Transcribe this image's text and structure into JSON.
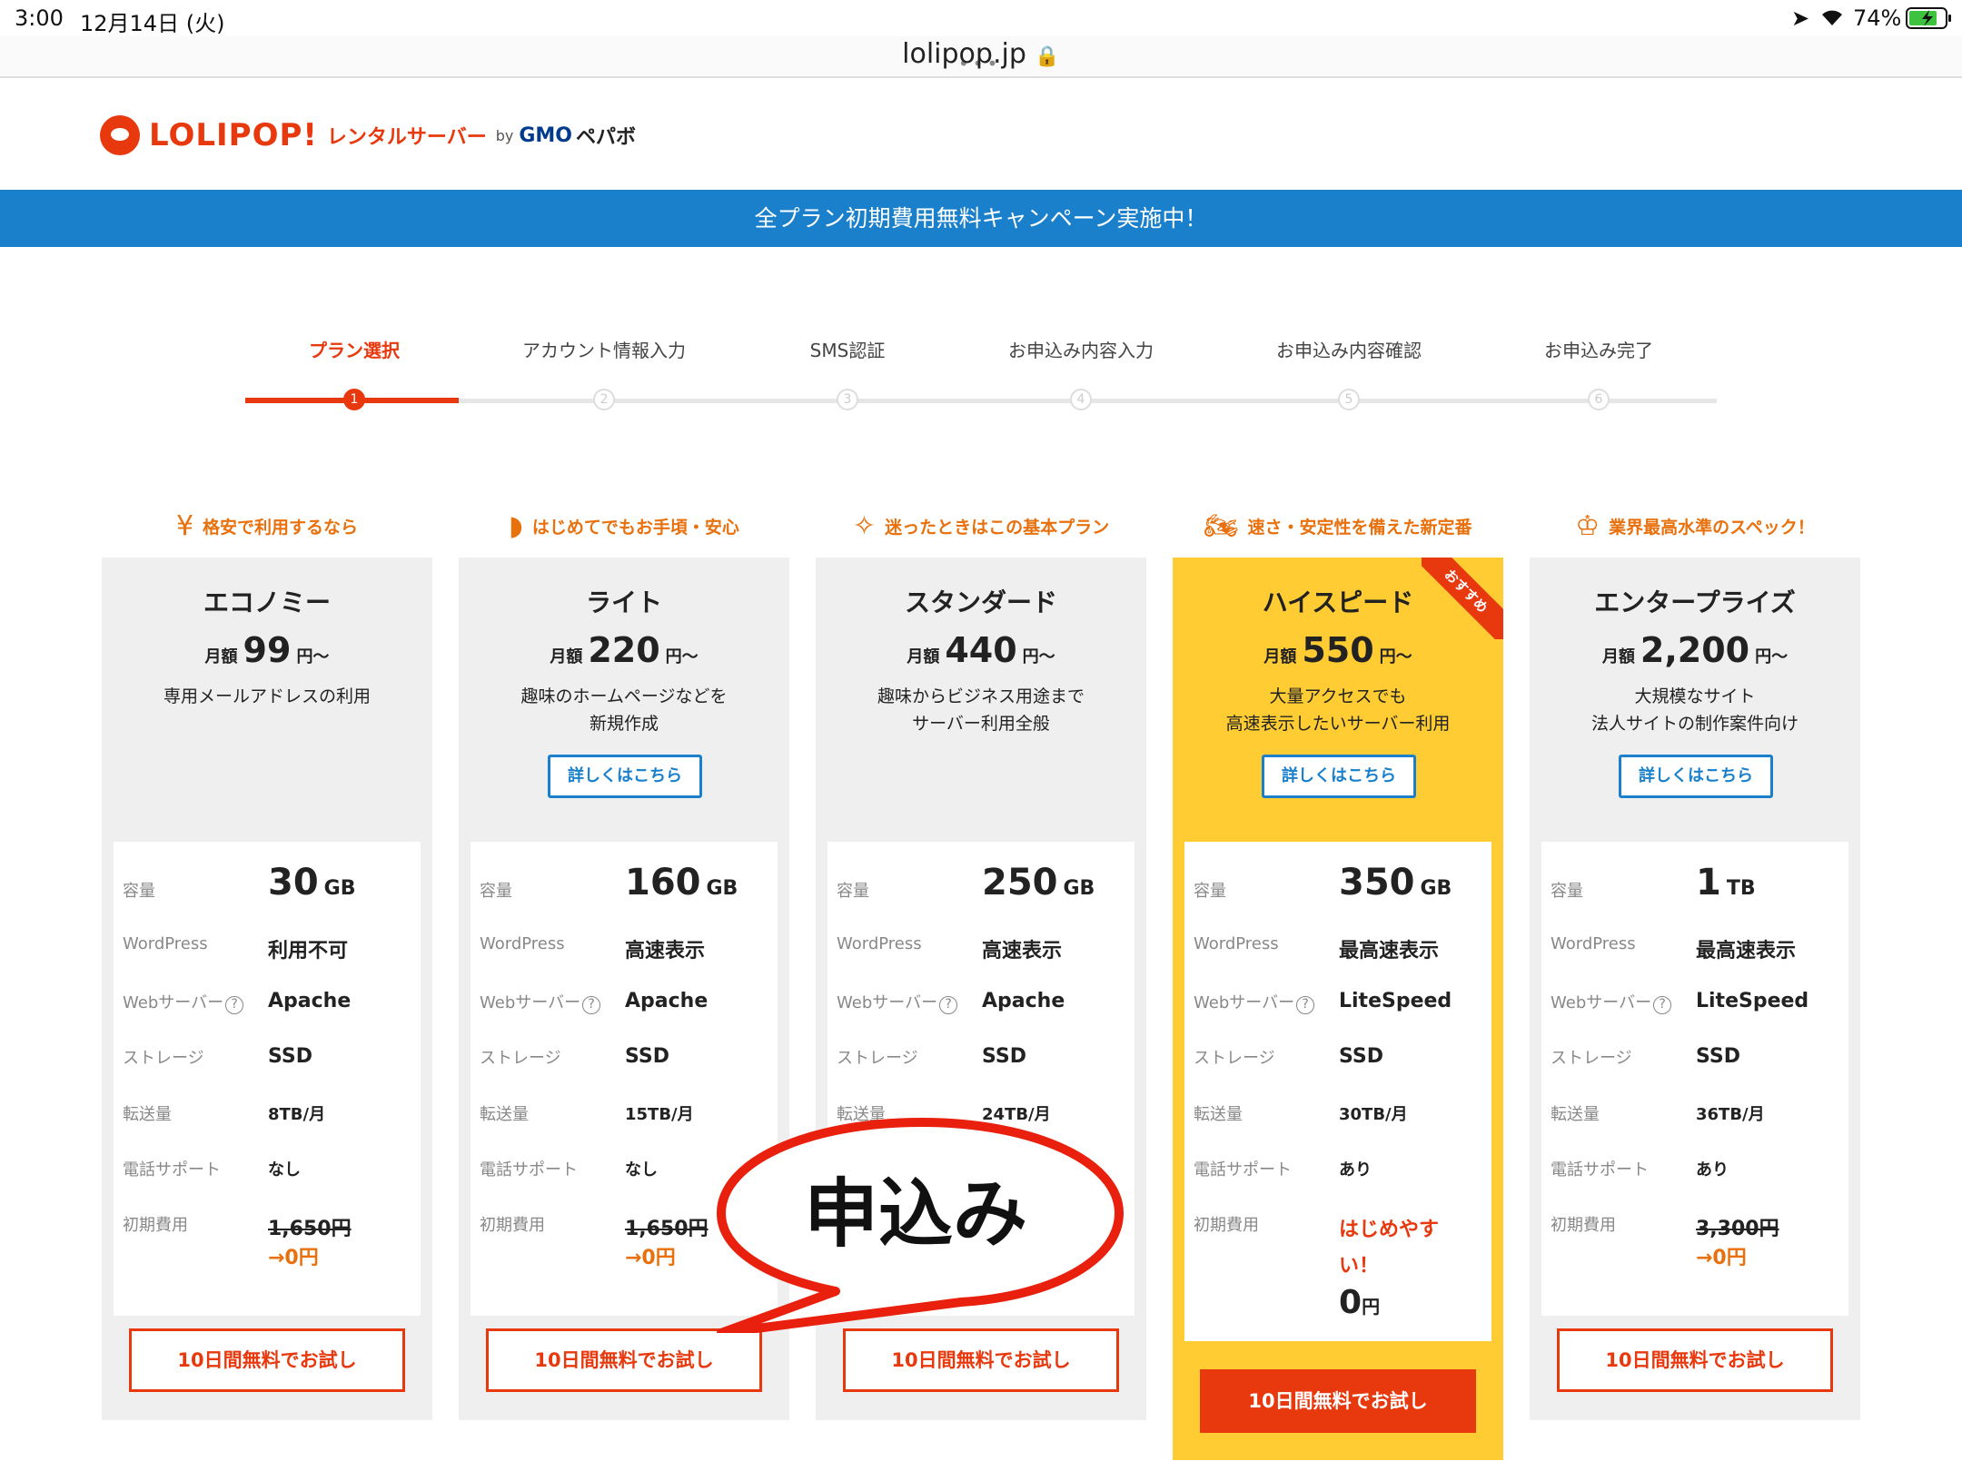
{
  "status": {
    "time": "3:00",
    "date": "12月14日 (火)",
    "battery": "74%"
  },
  "browser": {
    "url": "lolipop.jp"
  },
  "header": {
    "brand": "LOLIPOP!",
    "sub": "レンタルサーバー",
    "by": "by",
    "gmo": "GMO",
    "pepabo": "ペパボ"
  },
  "banner": "全プラン初期費用無料キャンペーン実施中！",
  "steps": [
    {
      "label": "プラン選択",
      "num": "1"
    },
    {
      "label": "アカウント情報入力",
      "num": "2"
    },
    {
      "label": "SMS認証",
      "num": "3"
    },
    {
      "label": "お申込み内容入力",
      "num": "4"
    },
    {
      "label": "お申込み内容確認",
      "num": "5"
    },
    {
      "label": "お申込み完了",
      "num": "6"
    }
  ],
  "labels": {
    "monthly": "月額",
    "yen_from": "円〜",
    "detail": "詳しくはこちら",
    "trial": "10日間無料でお試し",
    "capacity": "容量",
    "wordpress": "WordPress",
    "webserver": "Webサーバー",
    "storage": "ストレージ",
    "transfer": "転送量",
    "phone": "電話サポート",
    "initial": "初期費用",
    "recommend": "おすすめ",
    "help": "?"
  },
  "plans": [
    {
      "tagline": "格安で利用するなら",
      "icon": "yen-icon",
      "name": "エコノミー",
      "price": "99",
      "desc": "専用メールアドレスの利用",
      "capacity": "30",
      "unit": "GB",
      "wordpress": "利用不可",
      "webserver": "Apache",
      "storage": "SSD",
      "transfer": "8TB/月",
      "phone": "なし",
      "initial_old": "1,650円",
      "initial_new": "→0円"
    },
    {
      "tagline": "はじめてでもお手頃・安心",
      "icon": "beginner-mark-icon",
      "name": "ライト",
      "price": "220",
      "desc": "趣味のホームページなどを\n新規作成",
      "capacity": "160",
      "unit": "GB",
      "wordpress": "高速表示",
      "webserver": "Apache",
      "storage": "SSD",
      "transfer": "15TB/月",
      "phone": "なし",
      "initial_old": "1,650円",
      "initial_new": "→0円"
    },
    {
      "tagline": "迷ったときはこの基本プラン",
      "icon": "sparkle-icon",
      "name": "スタンダード",
      "price": "440",
      "desc": "趣味からビジネス用途まで\nサーバー利用全般",
      "capacity": "250",
      "unit": "GB",
      "wordpress": "高速表示",
      "webserver": "Apache",
      "storage": "SSD",
      "transfer": "24TB/月"
    },
    {
      "tagline": "速さ・安定性を備えた新定番",
      "icon": "motorcycle-icon",
      "name": "ハイスピード",
      "price": "550",
      "desc": "大量アクセスでも\n高速表示したいサーバー利用",
      "capacity": "350",
      "unit": "GB",
      "wordpress": "最高速表示",
      "webserver": "LiteSpeed",
      "storage": "SSD",
      "transfer": "30TB/月",
      "phone": "あり",
      "initial_a": "はじめやす",
      "initial_b": "い！",
      "initial_c": "0",
      "initial_c_unit": "円"
    },
    {
      "tagline": "業界最高水準のスペック！",
      "icon": "crown-icon",
      "name": "エンタープライズ",
      "price": "2,200",
      "desc": "大規模なサイト\n法人サイトの制作案件向け",
      "capacity": "1",
      "unit": "TB",
      "wordpress": "最高速表示",
      "webserver": "LiteSpeed",
      "storage": "SSD",
      "transfer": "36TB/月",
      "phone": "あり",
      "initial_old": "3,300円",
      "initial_new": "→0円"
    }
  ],
  "bubble": "申込み",
  "colors": {
    "accent": "#e8380d",
    "banner": "#1a80cc",
    "featured": "#ffcc33",
    "tagline": "#e8700d"
  }
}
